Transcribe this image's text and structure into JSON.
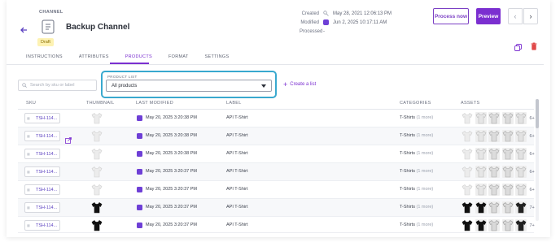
{
  "header": {
    "entity_type": "CHANNEL",
    "title": "Backup Channel",
    "status": "Draft",
    "back_icon": "arrow-left-icon"
  },
  "meta": {
    "created_label": "Created",
    "created_value": "May 28, 2021 12:06:13 PM",
    "modified_label": "Modified",
    "modified_value": "Jun 2, 2025 10:17:11 AM",
    "processed_label": "Processed",
    "processed_value": "-"
  },
  "actions": {
    "process_label": "Process now",
    "preview_label": "Preview",
    "prev_icon": "chevron-left-icon",
    "next_icon": "chevron-right-icon"
  },
  "tabs": [
    {
      "label": "INSTRUCTIONS",
      "active": false
    },
    {
      "label": "ATTRIBUTES",
      "active": false
    },
    {
      "label": "PRODUCTS",
      "active": true
    },
    {
      "label": "FORMAT",
      "active": false
    },
    {
      "label": "SETTINGS",
      "active": false
    }
  ],
  "search": {
    "placeholder": "Search by sku or label"
  },
  "product_list": {
    "label": "PRODUCT LIST",
    "selected": "All products",
    "create_label": "Create a list"
  },
  "table": {
    "columns": [
      "SKU",
      "THUMBNAIL",
      "LAST MODIFIED",
      "LABEL",
      "CATEGORIES",
      "ASSETS"
    ],
    "rows": [
      {
        "sku": "TSH-114...",
        "last_modified": "May 20, 2025 3:20:38 PM",
        "label": "API T-Shirt",
        "category": "T-Shirts",
        "category_more": "(1 more)",
        "assets_more": "6+",
        "thumb": "light",
        "edit": false
      },
      {
        "sku": "TSH-114...",
        "last_modified": "May 20, 2025 3:20:38 PM",
        "label": "API T-Shirt",
        "category": "T-Shirts",
        "category_more": "(1 more)",
        "assets_more": "6+",
        "thumb": "light",
        "edit": true
      },
      {
        "sku": "TSH-114...",
        "last_modified": "May 20, 2025 3:20:38 PM",
        "label": "API T-Shirt",
        "category": "T-Shirts",
        "category_more": "(1 more)",
        "assets_more": "6+",
        "thumb": "light",
        "edit": false
      },
      {
        "sku": "TSH-114...",
        "last_modified": "May 20, 2025 3:20:37 PM",
        "label": "API T-Shirt",
        "category": "T-Shirts",
        "category_more": "(1 more)",
        "assets_more": "6+",
        "thumb": "light",
        "edit": false
      },
      {
        "sku": "TSH-114...",
        "last_modified": "May 20, 2025 3:20:37 PM",
        "label": "API T-Shirt",
        "category": "T-Shirts",
        "category_more": "(1 more)",
        "assets_more": "6+",
        "thumb": "light",
        "edit": false
      },
      {
        "sku": "TSH-114...",
        "last_modified": "May 20, 2025 3:20:37 PM",
        "label": "API T-Shirt",
        "category": "T-Shirts",
        "category_more": "(1 more)",
        "assets_more": "7+",
        "thumb": "dark",
        "edit": false
      },
      {
        "sku": "TSH-114...",
        "last_modified": "May 20, 2025 3:20:37 PM",
        "label": "API T-Shirt",
        "category": "T-Shirts",
        "category_more": "(1 more)",
        "assets_more": "7+",
        "thumb": "dark",
        "edit": false
      }
    ]
  },
  "colors": {
    "accent": "#7b2fd0",
    "highlight": "#39a9cf",
    "draft_badge": "#fdf2b3",
    "delete": "#e04848"
  }
}
